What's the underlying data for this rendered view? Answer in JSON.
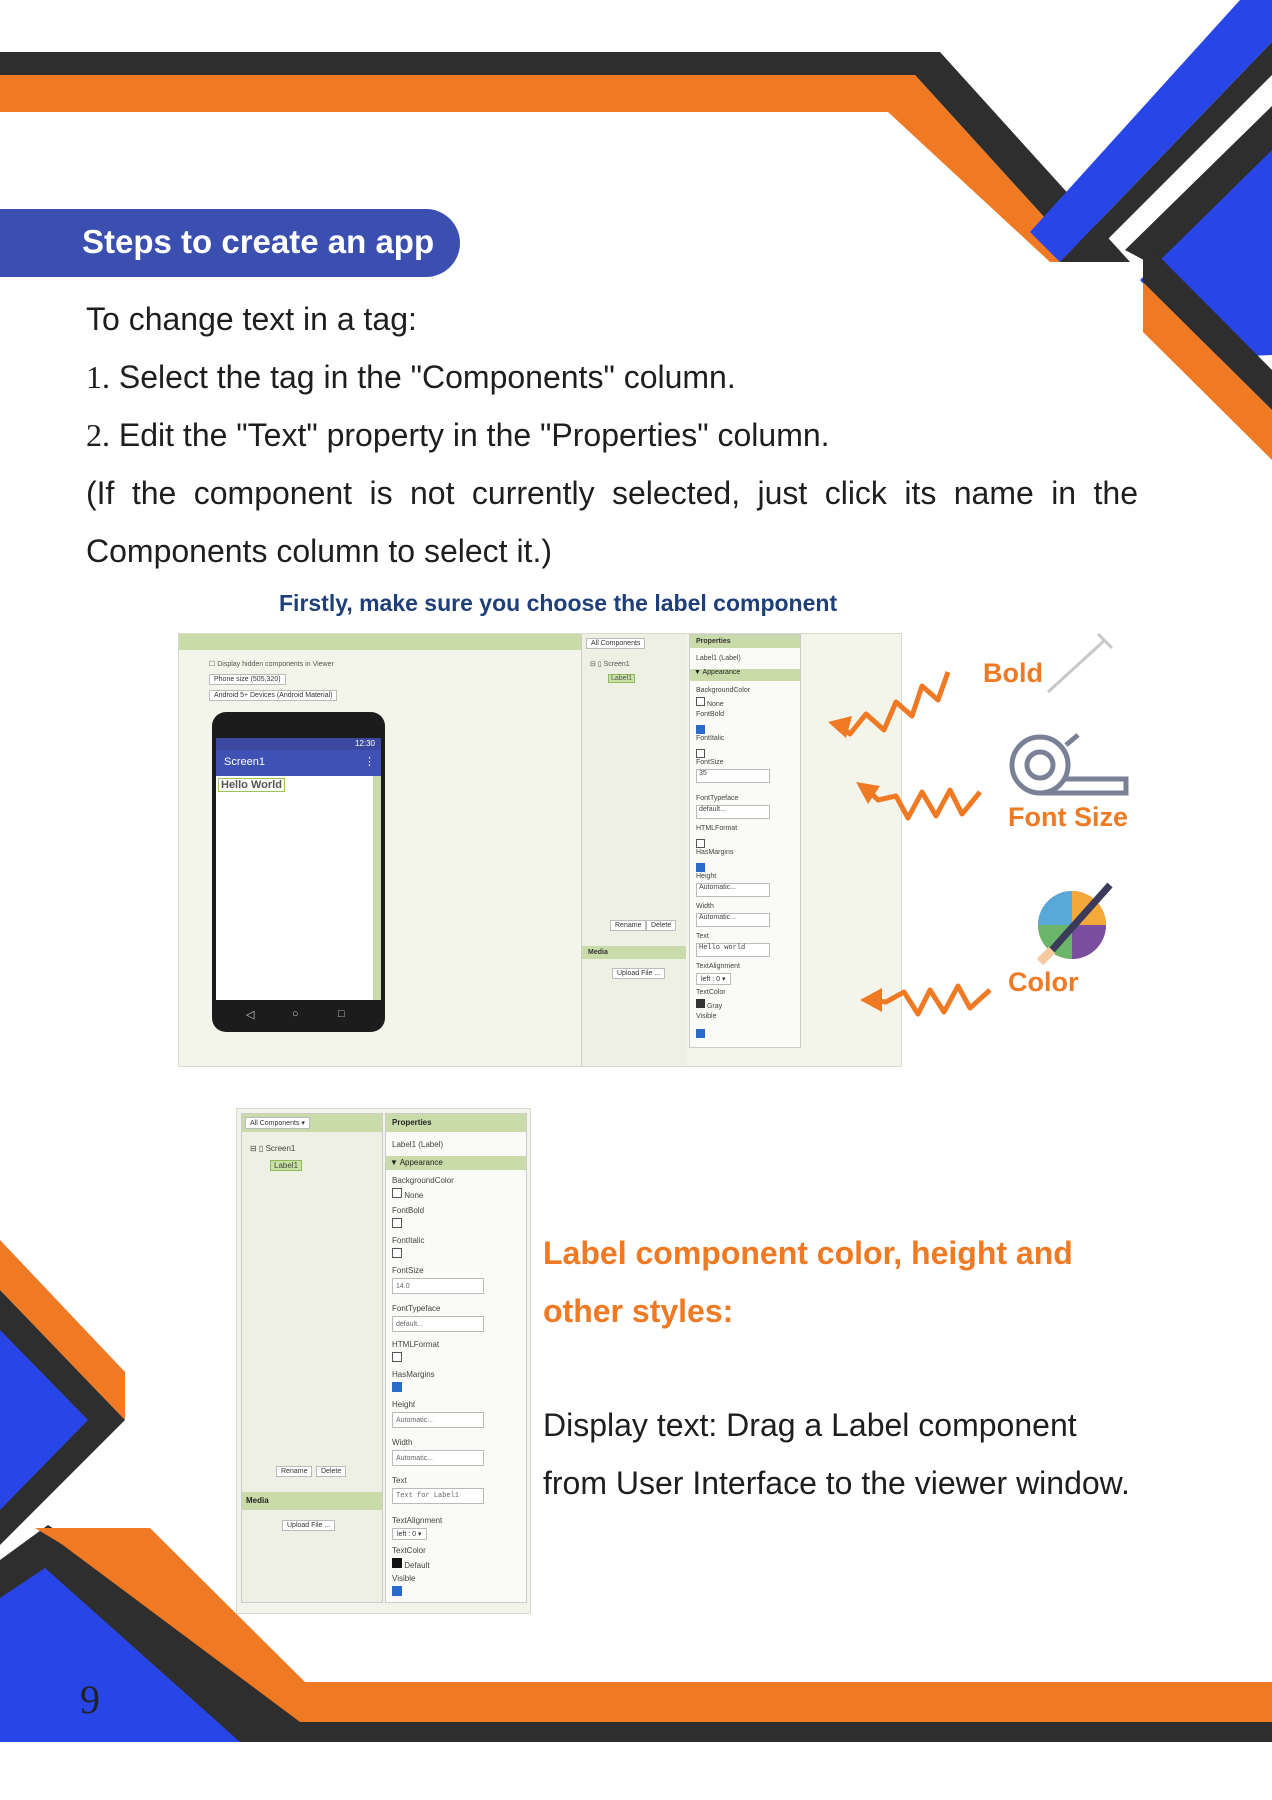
{
  "section": {
    "title": "Steps to create an app"
  },
  "intro": {
    "line1": "To change text in a tag:",
    "step1_num": "1.",
    "step1_text": "Select the tag in the \"Components\" column.",
    "step2_num": "2.",
    "step2_text": "Edit the \"Text\" property in the \"Properties\" column.",
    "note_line1": "(If the component is not currently selected, just click its name in the",
    "note_line2": "Components column to select it.)"
  },
  "figure1": {
    "caption": "Firstly, make sure you choose the label component",
    "viewer": {
      "checkbox_label": "Display hidden components in Viewer",
      "phone_size": "Phone size (505,320)",
      "theme": "Android 5+ Devices (Android Material)",
      "status_time": "12:30",
      "app_title": "Screen1",
      "label_text": "Hello World"
    },
    "components": {
      "dropdown": "All Components",
      "screen": "Screen1",
      "label": "Label1",
      "rename": "Rename",
      "delete": "Delete",
      "media": "Media",
      "upload": "Upload File ..."
    },
    "properties": {
      "header": "Properties",
      "selected": "Label1 (Label)",
      "group": "▼ Appearance",
      "bg_label": "BackgroundColor",
      "bg_value": "None",
      "bold_label": "FontBold",
      "italic_label": "FontItalic",
      "size_label": "FontSize",
      "size_value": "35",
      "typeface_label": "FontTypeface",
      "typeface_value": "default...",
      "html_label": "HTMLFormat",
      "margins_label": "HasMargins",
      "height_label": "Height",
      "height_value": "Automatic...",
      "width_label": "Width",
      "width_value": "Automatic...",
      "text_label": "Text",
      "text_value": "Hello world",
      "align_label": "TextAlignment",
      "align_value": "left : 0 ▾",
      "color_label": "TextColor",
      "color_value": "Gray",
      "visible_label": "Visible"
    },
    "annotations": {
      "bold": "Bold",
      "font_size": "Font Size",
      "color": "Color"
    }
  },
  "figure2": {
    "components": {
      "dropdown": "All Components ▾",
      "screen": "Screen1",
      "label": "Label1",
      "rename": "Rename",
      "delete": "Delete",
      "media": "Media",
      "upload": "Upload File ..."
    },
    "properties": {
      "header": "Properties",
      "selected": "Label1 (Label)",
      "group": "▼ Appearance",
      "bg_label": "BackgroundColor",
      "bg_value": "None",
      "bold_label": "FontBold",
      "italic_label": "FontItalic",
      "size_label": "FontSize",
      "size_value": "14.0",
      "typeface_label": "FontTypeface",
      "typeface_value": "default...",
      "html_label": "HTMLFormat",
      "margins_label": "HasMargins",
      "height_label": "Height",
      "height_value": "Automatic...",
      "width_label": "Width",
      "width_value": "Automatic...",
      "text_label": "Text",
      "text_value": "Text for Label1",
      "align_label": "TextAlignment",
      "align_value": "left : 0 ▾",
      "color_label": "TextColor",
      "color_value": "Default",
      "visible_label": "Visible"
    }
  },
  "side_text": {
    "heading_line1": "Label component color, height and",
    "heading_line2": "other styles:",
    "body_line1": "Display text: Drag a Label component",
    "body_line2": "from User Interface to the viewer window."
  },
  "page_number": "9",
  "colors": {
    "orange": "#f07a24",
    "dark": "#2e2e2e",
    "blue": "#2846e8",
    "pill": "#3a4fb0",
    "caption": "#1f3f7a"
  }
}
